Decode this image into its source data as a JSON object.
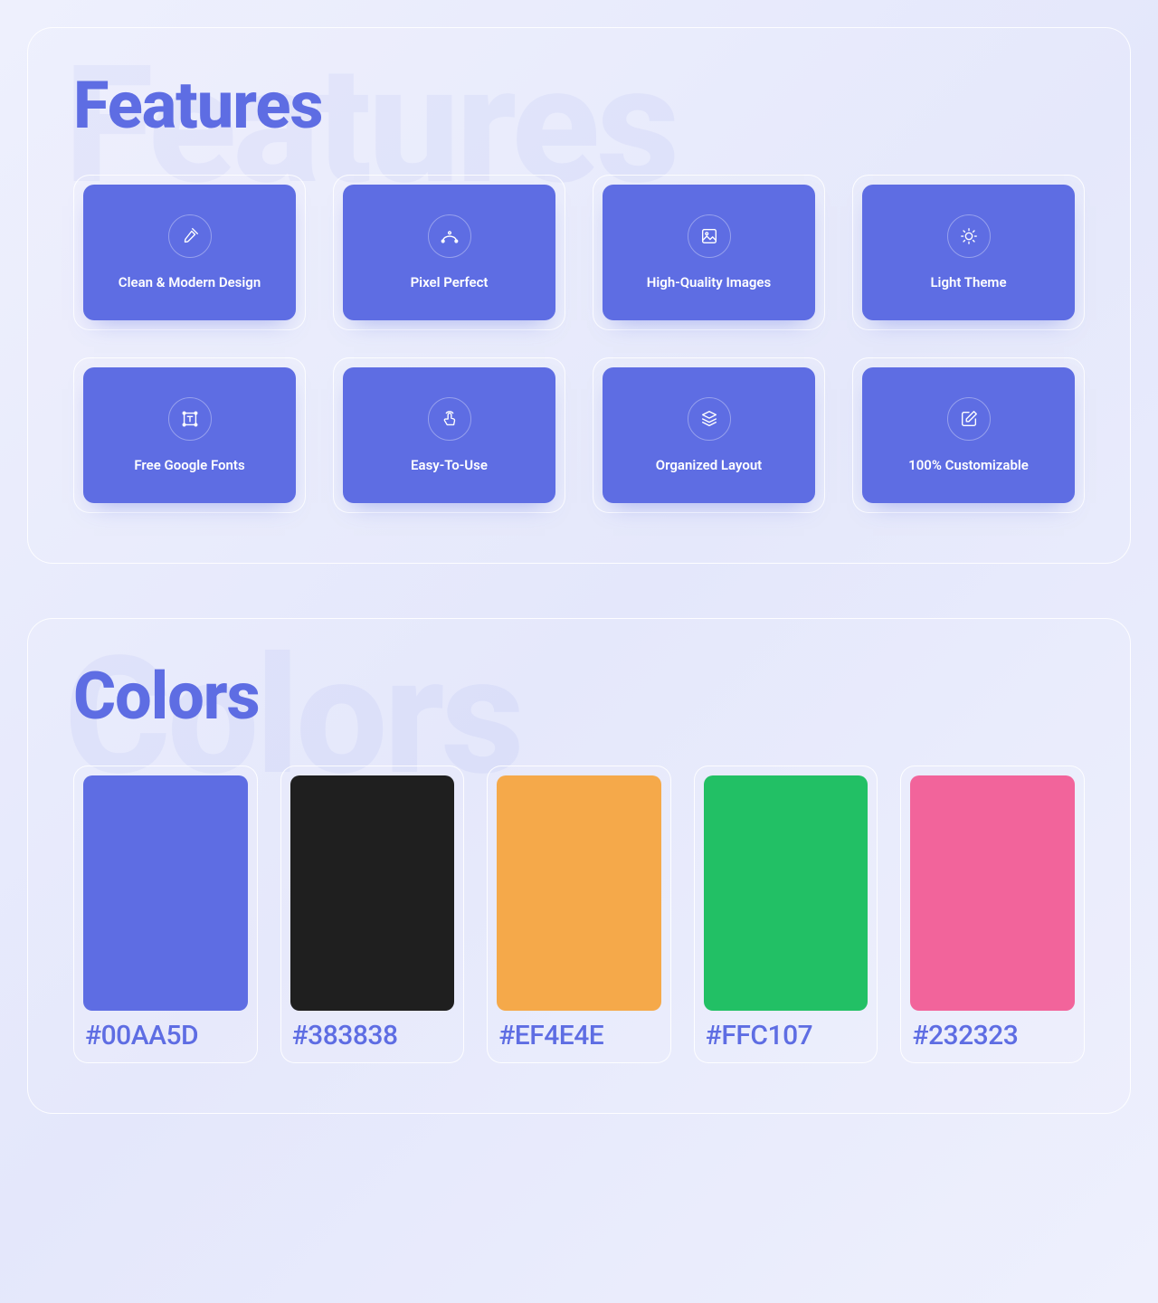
{
  "features": {
    "title": "Features",
    "bg_title": "Features",
    "items": [
      {
        "label": "Clean & Modern Design",
        "icon": "brush"
      },
      {
        "label": "Pixel Perfect",
        "icon": "vector"
      },
      {
        "label": "High-Quality Images",
        "icon": "image"
      },
      {
        "label": "Light Theme",
        "icon": "sun"
      },
      {
        "label": "Free Google Fonts",
        "icon": "text-frame"
      },
      {
        "label": "Easy-To-Use",
        "icon": "tap"
      },
      {
        "label": "Organized Layout",
        "icon": "layers"
      },
      {
        "label": "100% Customizable",
        "icon": "edit"
      }
    ]
  },
  "colors": {
    "title": "Colors",
    "bg_title": "Colors",
    "items": [
      {
        "swatch": "#5E6DE3",
        "code": "#00AA5D"
      },
      {
        "swatch": "#1F1F1F",
        "code": "#383838"
      },
      {
        "swatch": "#F5A94A",
        "code": "#EF4E4E"
      },
      {
        "swatch": "#22C065",
        "code": "#FFC107"
      },
      {
        "swatch": "#F2649B",
        "code": "#232323"
      }
    ]
  }
}
